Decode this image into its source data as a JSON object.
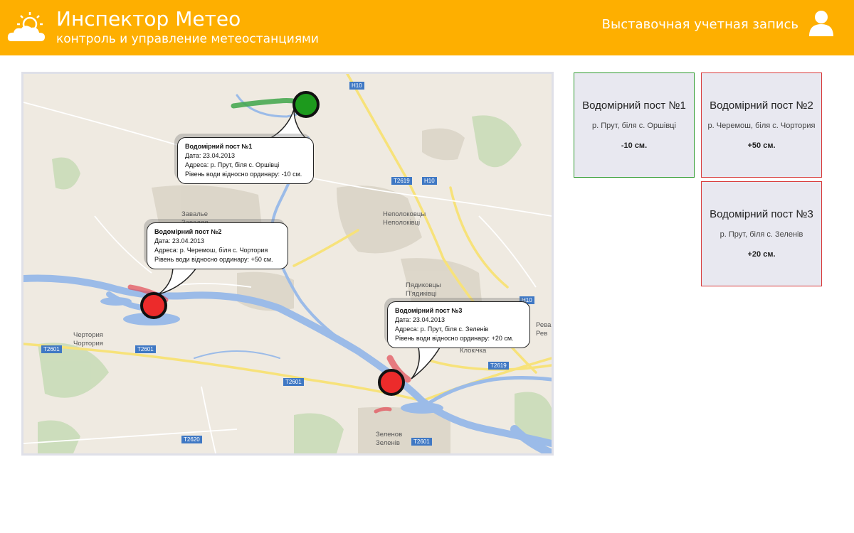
{
  "header": {
    "title": "Инспектор Метео",
    "subtitle": "контроль и управление метеостанциями",
    "account_label": "Выставочная учетная запись",
    "logo_icon": "cloud-sun-icon",
    "user_icon": "user-icon",
    "background_color": "#FEAF00"
  },
  "map": {
    "roads": [
      "H10",
      "H10",
      "T2619",
      "T2619",
      "T2601",
      "T2601",
      "T2601",
      "T2601",
      "T2620",
      "H10"
    ],
    "places": [
      {
        "ru": "Завалье",
        "ua": "Завалля"
      },
      {
        "ru": "Чертория",
        "ua": "Чортория"
      },
      {
        "ru": "Неполоковцы",
        "ua": "Неполоківці"
      },
      {
        "ru": "Пядиковцы",
        "ua": "П'ядиківці"
      },
      {
        "ru": "Зеленов",
        "ua": "Зеленів"
      },
      {
        "ru": "Ревак",
        "ua": "Рев"
      },
      {
        "ru": "",
        "ua": "Клокічка"
      }
    ]
  },
  "popups": [
    {
      "title": "Водомірний пост №1",
      "date": "Дата: 23.04.2013",
      "address": "Адреса: р. Прут, біля с. Оршівці",
      "level": "Рівень води відносно ординару: -10 см."
    },
    {
      "title": "Водомірний пост №2",
      "date": "Дата: 23.04.2013",
      "address": "Адреса: р. Черемош, біля с. Чортория",
      "level": "Рівень води відносно ординару: +50 см."
    },
    {
      "title": "Водомірний пост №3",
      "date": "Дата: 23.04.2013",
      "address": "Адреса: р. Прут, біля с. Зеленів",
      "level": "Рівень води відносно ординару: +20 см."
    }
  ],
  "cards": [
    {
      "title": "Водомірний пост №1",
      "address": "р. Прут, біля с. Оршівці",
      "value": "-10 см.",
      "status_color": "#2e9a2e"
    },
    {
      "title": "Водомірний пост №2",
      "address": "р. Черемош, біля с. Чортория",
      "value": "+50 см.",
      "status_color": "#d83a3a"
    },
    {
      "title": "Водомірний пост №3",
      "address": "р. Прут, біля с. Зеленів",
      "value": "+20 см.",
      "status_color": "#d83a3a"
    }
  ]
}
